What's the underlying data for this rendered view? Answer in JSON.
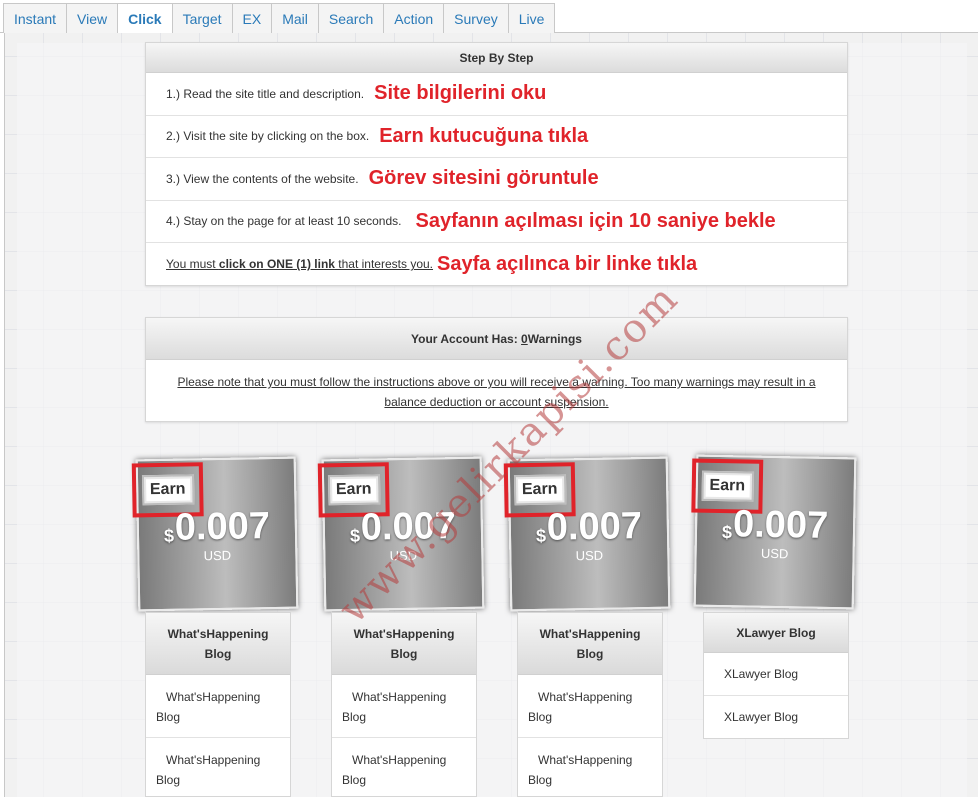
{
  "tabs": [
    "Instant",
    "View",
    "Click",
    "Target",
    "EX",
    "Mail",
    "Search",
    "Action",
    "Survey",
    "Live"
  ],
  "active_tab": "Click",
  "steps_panel": {
    "title": "Step By Step",
    "steps": [
      {
        "text": "1.) Read the site title and description.",
        "annotation": "Site bilgilerini oku"
      },
      {
        "text": "2.) Visit the site by clicking on the box.",
        "annotation": "Earn kutucuğuna tıkla"
      },
      {
        "text": "3.) View the contents of the website.",
        "annotation": "Görev sitesini göruntule"
      },
      {
        "text": "4.) Stay on the page for at least 10 seconds.",
        "annotation": "Sayfanın açılması için 10 saniye bekle"
      },
      {
        "text_prefix": "You must ",
        "text_bold": "click on ONE (1) link",
        "text_suffix": " that interests you.",
        "annotation": "Sayfa açılınca bir linke tıkla"
      }
    ]
  },
  "warnings_panel": {
    "title_prefix": "Your Account Has: ",
    "count": "0",
    "title_suffix": " Warnings",
    "note": "Please note that you must follow the instructions above or you will receive a warning. Too many warnings may result in a balance deduction or account suspension."
  },
  "earn_label": "Earn",
  "currency_symbol": "$",
  "ads": [
    {
      "amount": "0.007",
      "unit": "USD",
      "title": "What'sHappening Blog",
      "links": [
        "What'sHappening Blog",
        "What'sHappening Blog"
      ]
    },
    {
      "amount": "0.007",
      "unit": "USD",
      "title": "What'sHappening Blog",
      "links": [
        "What'sHappening Blog",
        "What'sHappening Blog"
      ]
    },
    {
      "amount": "0.007",
      "unit": "USD",
      "title": "What'sHappening Blog",
      "links": [
        "What'sHappening Blog",
        "What'sHappening Blog"
      ]
    },
    {
      "amount": "0.007",
      "unit": "USD",
      "title": "XLawyer Blog",
      "links": [
        "XLawyer Blog",
        "XLawyer Blog"
      ]
    }
  ],
  "watermark": "www.gelirkapisi.com",
  "colors": {
    "annotation": "#e0232a",
    "tab_text": "#2a7ab8"
  }
}
